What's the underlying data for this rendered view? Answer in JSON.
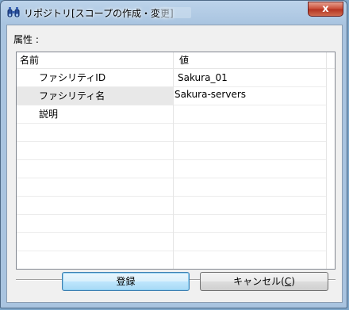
{
  "window": {
    "title": "リポジトリ[スコープの作成・変更]",
    "close_glyph": "x"
  },
  "properties": {
    "label": "属性 :",
    "columns": {
      "name": "名前",
      "value": "値"
    },
    "rows": [
      {
        "name": "ファシリティID",
        "value": "Sakura_01"
      },
      {
        "name": "ファシリティ名",
        "value": "Sakura-servers"
      },
      {
        "name": "説明",
        "value": ""
      }
    ]
  },
  "buttons": {
    "register": "登録",
    "cancel_prefix": "キャンセル(",
    "cancel_mnemonic": "C",
    "cancel_suffix": ")"
  },
  "colors": {
    "frame": "#a9c4e0",
    "close": "#c84a34",
    "primary_button": "#bee6fd"
  },
  "icons": {
    "app": "binoculars-icon",
    "close": "close-icon"
  }
}
